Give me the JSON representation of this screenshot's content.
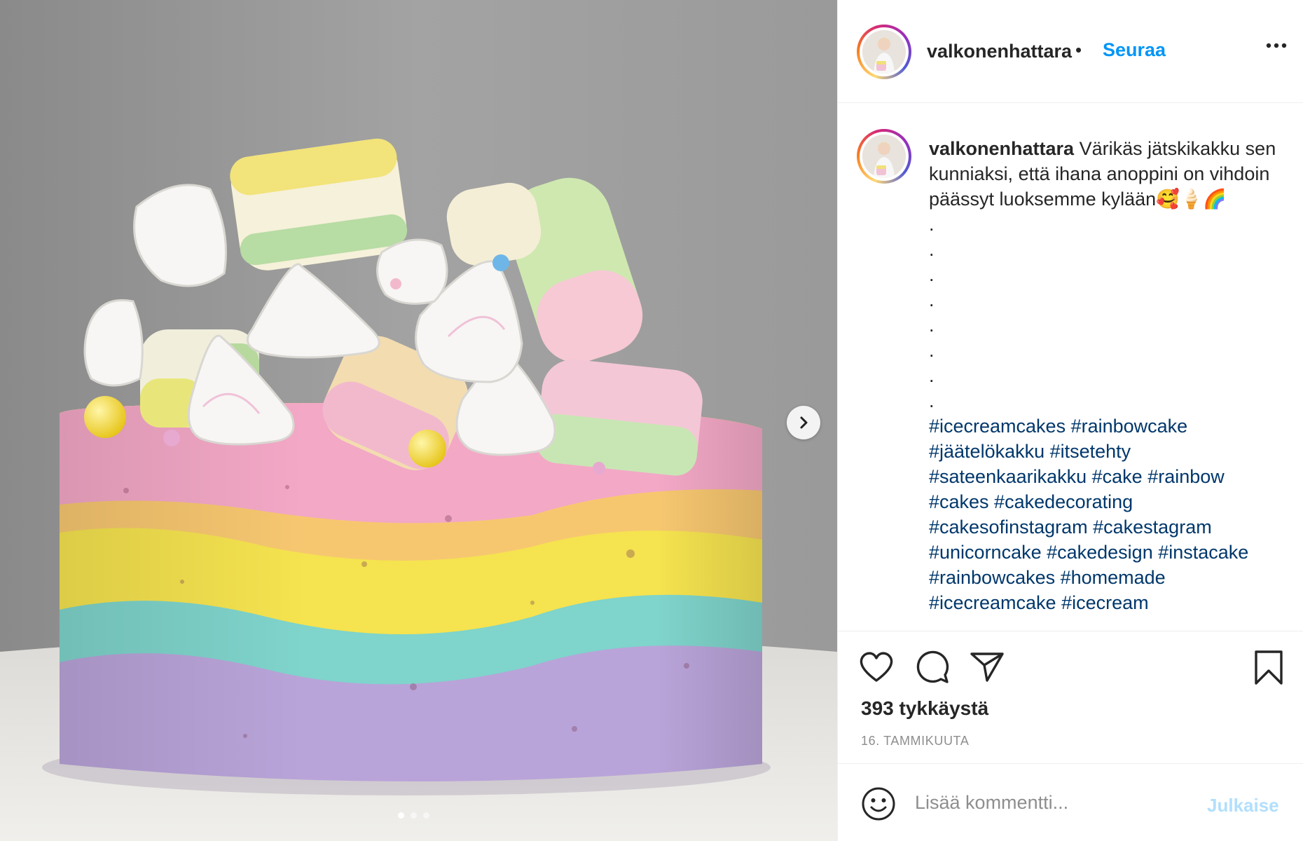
{
  "colors": {
    "accent": "#0095f6",
    "hashtag": "#00376b",
    "muted": "#8e8e8e",
    "publish_disabled": "#b2dffc",
    "border": "#efefef"
  },
  "media": {
    "slide_count": 3,
    "active_slide": 1,
    "next_icon": "chevron-right-icon"
  },
  "header": {
    "username": "valkonenhattara",
    "separator": "•",
    "follow_label": "Seuraa",
    "more_icon": "more-horizontal-icon"
  },
  "caption": {
    "username": "valkonenhattara",
    "text": "Värikäs jätskikakku sen kunniaksi, että ihana anoppini on vihdoin päässyt luoksemme kylään🥰🍦🌈",
    "dot_lines": [
      ".",
      ".",
      ".",
      ".",
      ".",
      ".",
      ".",
      "."
    ],
    "hashtag_lines": [
      "#icecreamcakes #rainbowcake",
      "#jäätelökakku #itsetehty",
      "#sateenkaarikakku #cake #rainbow",
      "#cakes #cakedecorating",
      "#cakesofinstagram #cakestagram",
      "#unicorncake #cakedesign #instacake",
      "#rainbowcakes #homemade",
      "#icecreamcake #icecream"
    ]
  },
  "actions": {
    "like_icon": "heart-icon",
    "comment_icon": "comment-icon",
    "share_icon": "send-icon",
    "save_icon": "bookmark-icon",
    "likes_text": "393 tykkäystä",
    "date_text": "16. TAMMIKUUTA"
  },
  "comment_bar": {
    "emoji_icon": "smiley-icon",
    "placeholder": "Lisää kommentti...",
    "publish_label": "Julkaise"
  }
}
